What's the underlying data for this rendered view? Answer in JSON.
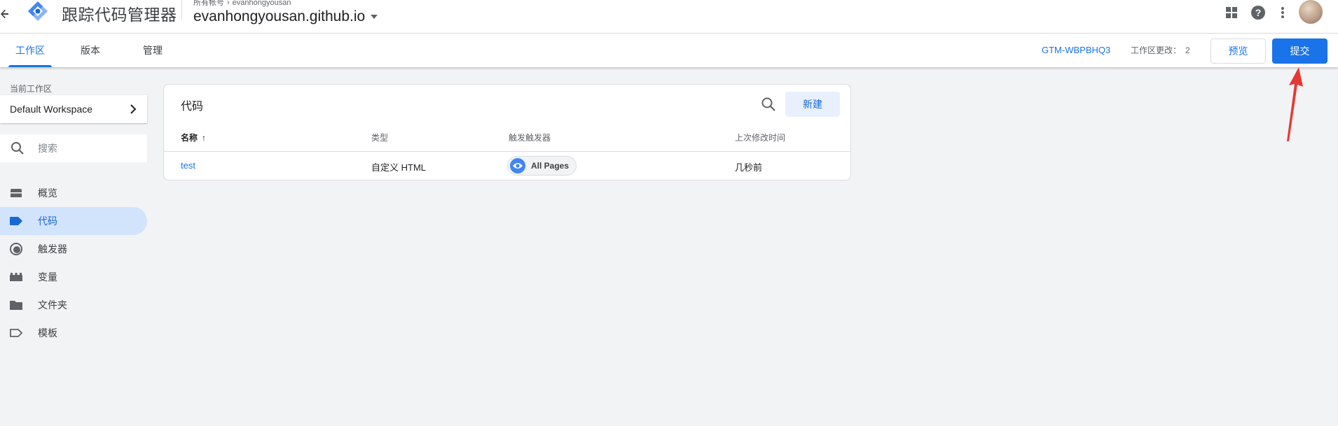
{
  "header": {
    "app_title": "跟踪代码管理器",
    "breadcrumb": [
      "所有帐号",
      "evanhongyousan"
    ],
    "container_name": "evanhongyousan.github.io",
    "icons": [
      "back-arrow-icon",
      "gtm-logo-icon",
      "apps-grid-icon",
      "help-icon",
      "more-vert-icon"
    ]
  },
  "tabs": [
    {
      "label": "工作区",
      "active": true
    },
    {
      "label": "版本",
      "active": false
    },
    {
      "label": "管理",
      "active": false
    }
  ],
  "toolbar": {
    "container_id": "GTM-WBPBHQ3",
    "workspace_changes_label": "工作区更改：",
    "workspace_changes_count": "2",
    "preview_label": "预览",
    "submit_label": "提交"
  },
  "sidebar": {
    "current_workspace_label": "当前工作区",
    "workspace_name": "Default Workspace",
    "search_placeholder": "搜索",
    "items": [
      {
        "label": "概览",
        "icon": "overview-icon",
        "active": false
      },
      {
        "label": "代码",
        "icon": "tag-icon",
        "active": true
      },
      {
        "label": "触发器",
        "icon": "trigger-icon",
        "active": false
      },
      {
        "label": "变量",
        "icon": "variable-icon",
        "active": false
      },
      {
        "label": "文件夹",
        "icon": "folder-icon",
        "active": false
      },
      {
        "label": "模板",
        "icon": "template-icon",
        "active": false
      }
    ]
  },
  "tags_card": {
    "title": "代码",
    "new_button_label": "新建",
    "columns": [
      "名称",
      "类型",
      "触发触发器",
      "上次修改时间"
    ],
    "rows": [
      {
        "name": "test",
        "type": "自定义 HTML",
        "trigger": "All Pages",
        "modified": "几秒前"
      }
    ]
  },
  "colors": {
    "accent": "#1a73e8",
    "active_nav_bg": "#d2e3fc",
    "annotation_arrow": "#e53935"
  }
}
